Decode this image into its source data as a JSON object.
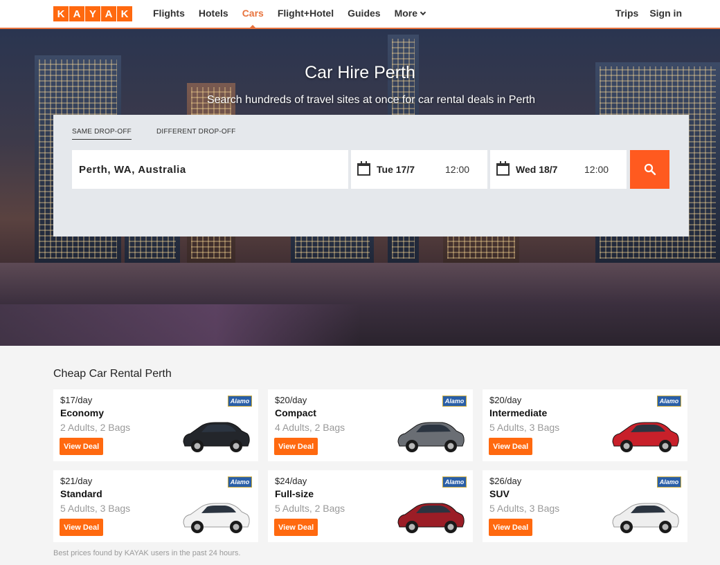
{
  "brand": {
    "logo_letters": [
      "K",
      "A",
      "Y",
      "A",
      "K"
    ]
  },
  "nav": {
    "items": [
      {
        "label": "Flights"
      },
      {
        "label": "Hotels"
      },
      {
        "label": "Cars"
      },
      {
        "label": "Flight+Hotel"
      },
      {
        "label": "Guides"
      },
      {
        "label": "More"
      }
    ],
    "trips": "Trips",
    "signin": "Sign in"
  },
  "hero": {
    "title": "Car Hire Perth",
    "subtitle": "Search hundreds of travel sites at once for car rental deals in Perth"
  },
  "search": {
    "tabs": [
      "SAME DROP-OFF",
      "DIFFERENT DROP-OFF"
    ],
    "location": "Perth, WA, Australia",
    "pickup": {
      "date": "Tue 17/7",
      "time": "12:00"
    },
    "dropoff": {
      "date": "Wed 18/7",
      "time": "12:00"
    }
  },
  "deals": {
    "title": "Cheap Car Rental Perth",
    "cards": [
      {
        "price": "$17/day",
        "class": "Economy",
        "capacity": "2 Adults, 2 Bags",
        "button": "View Deal",
        "vendor": "Alamo",
        "car_color": "#23262b"
      },
      {
        "price": "$20/day",
        "class": "Compact",
        "capacity": "4 Adults, 2 Bags",
        "button": "View Deal",
        "vendor": "Alamo",
        "car_color": "#6a6e74"
      },
      {
        "price": "$20/day",
        "class": "Intermediate",
        "capacity": "5 Adults, 3 Bags",
        "button": "View Deal",
        "vendor": "Alamo",
        "car_color": "#c8202a"
      },
      {
        "price": "$21/day",
        "class": "Standard",
        "capacity": "5 Adults, 3 Bags",
        "button": "View Deal",
        "vendor": "Alamo",
        "car_color": "#f2f2f2"
      },
      {
        "price": "$24/day",
        "class": "Full-size",
        "capacity": "5 Adults, 2 Bags",
        "button": "View Deal",
        "vendor": "Alamo",
        "car_color": "#9b1d26"
      },
      {
        "price": "$26/day",
        "class": "SUV",
        "capacity": "5 Adults, 3 Bags",
        "button": "View Deal",
        "vendor": "Alamo",
        "car_color": "#eeeeee"
      }
    ],
    "footnote": "Best prices found by KAYAK users in the past 24 hours."
  },
  "colors": {
    "accent": "#ff690f",
    "nav_active": "#e8733d",
    "panel": "#e5e8ec"
  }
}
